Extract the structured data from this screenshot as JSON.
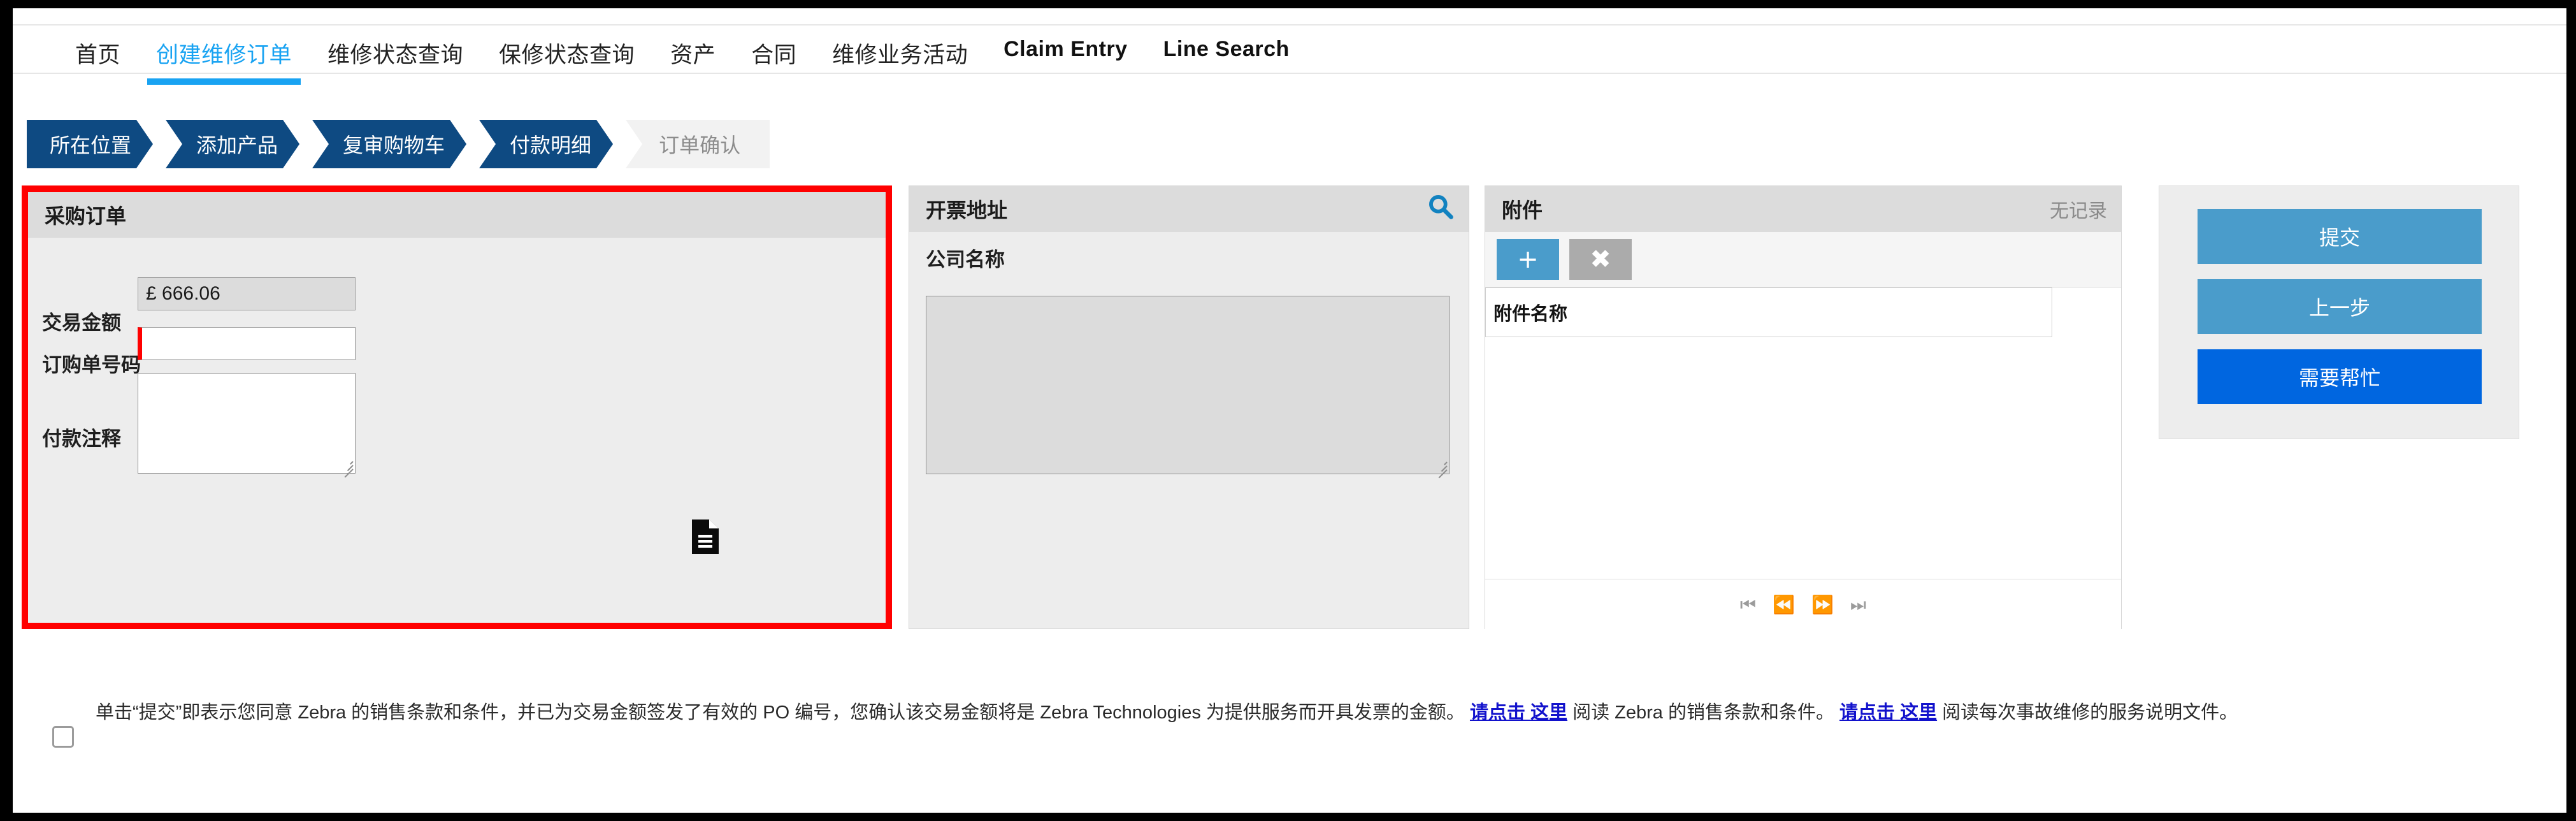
{
  "nav": {
    "items": [
      {
        "label": "首页",
        "active": false,
        "latin": false
      },
      {
        "label": "创建维修订单",
        "active": true,
        "latin": false
      },
      {
        "label": "维修状态查询",
        "active": false,
        "latin": false
      },
      {
        "label": "保修状态查询",
        "active": false,
        "latin": false
      },
      {
        "label": "资产",
        "active": false,
        "latin": false
      },
      {
        "label": "合同",
        "active": false,
        "latin": false
      },
      {
        "label": "维修业务活动",
        "active": false,
        "latin": false
      },
      {
        "label": "Claim Entry",
        "active": false,
        "latin": true
      },
      {
        "label": "Line Search",
        "active": false,
        "latin": true
      }
    ]
  },
  "breadcrumb": {
    "steps": [
      {
        "label": "所在位置",
        "state": "done"
      },
      {
        "label": "添加产品",
        "state": "done"
      },
      {
        "label": "复审购物车",
        "state": "done"
      },
      {
        "label": "付款明细",
        "state": "current"
      },
      {
        "label": "订单确认",
        "state": "pending"
      }
    ]
  },
  "purchase_order": {
    "title": "采购订单",
    "transaction_amount_label": "交易金额",
    "transaction_amount_value": "£ 666.06",
    "po_number_label": "订购单号码",
    "po_number_value": "",
    "po_number_placeholder": "",
    "payment_notes_label": "付款注释",
    "payment_notes_value": "",
    "payment_notes_placeholder": "",
    "doc_icon": "document-icon",
    "highlight_color": "#FF0000"
  },
  "billing": {
    "title": "开票地址",
    "search_icon": "search-icon",
    "search_icon_color": "#1282C0",
    "company_name_label": "公司名称",
    "address_value": "",
    "address_placeholder": ""
  },
  "attachments": {
    "title": "附件",
    "record_status": "无记录",
    "add_button_label": "+",
    "add_button_icon": "plus-icon",
    "delete_button_label": "✖",
    "delete_button_icon": "close-icon",
    "columns": [
      "附件名称"
    ],
    "rows": [],
    "pager": [
      {
        "icon": "first-page-icon",
        "glyph": "⏮"
      },
      {
        "icon": "prev-page-icon",
        "glyph": "⏪"
      },
      {
        "icon": "next-page-icon",
        "glyph": "⏩"
      },
      {
        "icon": "last-page-icon",
        "glyph": "⏭"
      }
    ]
  },
  "actions": {
    "submit_label": "提交",
    "back_label": "上一步",
    "help_label": "需要帮忙",
    "submit_color": "#4A9CCB",
    "back_color": "#4A9CCB",
    "help_color": "#0066E0"
  },
  "terms": {
    "checked": false,
    "p1": "单击“提交”即表示您同意 Zebra 的销售条款和条件，并已为交易金额签发了有效的 PO 编号，您确认该交易金额将是 Zebra Technologies 为提供服务而开具发票的金额。",
    "link1": "请点击 这里",
    "p2": "阅读 Zebra 的销售条款和条件。",
    "link2_part1": "请",
    "link2_part2": "点击 这里",
    "p3": "阅读每次事故维修的服务说明文件。"
  }
}
